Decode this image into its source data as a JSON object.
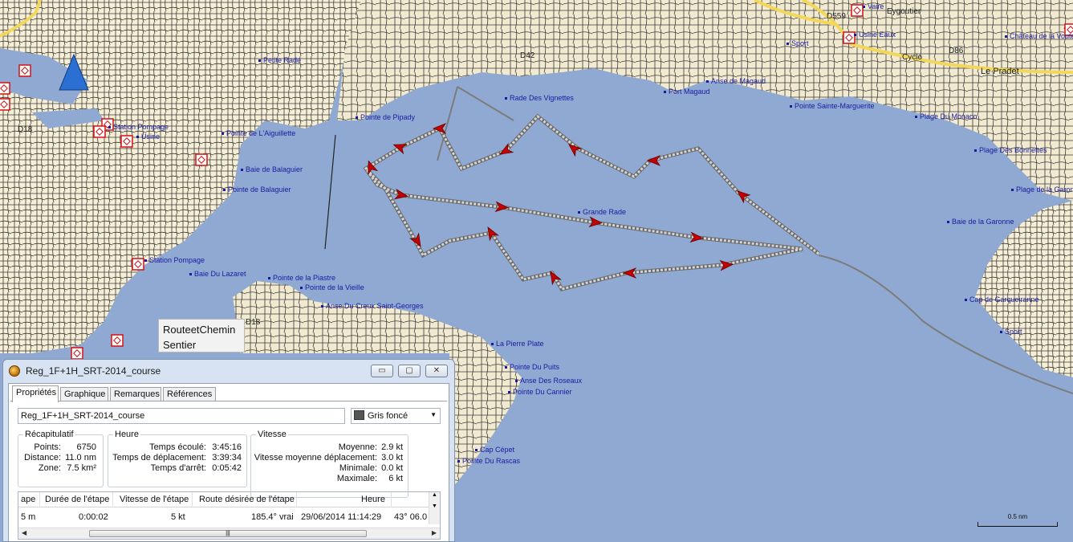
{
  "map": {
    "labels": [
      {
        "text": "Petite Rade"
      },
      {
        "text": "Rade Des Vignettes"
      },
      {
        "text": "Pointe de Pipady"
      },
      {
        "text": "Pointe de L'Aiguillette"
      },
      {
        "text": "Baie de Balaguier"
      },
      {
        "text": "Pointe de Balaguier"
      },
      {
        "text": "Station Pompage"
      },
      {
        "text": "Usine"
      },
      {
        "text": "Station Pompage"
      },
      {
        "text": "Baie Du Lazaret"
      },
      {
        "text": "Pointe de la Piastre"
      },
      {
        "text": "Pointe de la Vieille"
      },
      {
        "text": "Anse Du Creux Saint-Georges"
      },
      {
        "text": "Grande Rade"
      },
      {
        "text": "Port Magaud"
      },
      {
        "text": "Anse de Magaud"
      },
      {
        "text": "Pointe Sainte-Marguerite"
      },
      {
        "text": "Plage Du Monaco"
      },
      {
        "text": "Plage Des Bonnettes"
      },
      {
        "text": "Plage de la Garonne"
      },
      {
        "text": "Baie de la Garonne"
      },
      {
        "text": "Cap de Garqueiranne"
      },
      {
        "text": "Sport"
      },
      {
        "text": "La Pierre Plate"
      },
      {
        "text": "Pointe Du Puits"
      },
      {
        "text": "Anse Des Roseaux"
      },
      {
        "text": "Pointe Du Cannier"
      },
      {
        "text": "Cap Cépet"
      },
      {
        "text": "Pointe Du Rascas"
      },
      {
        "text": "Usine Eaux"
      },
      {
        "text": "Château de la Voute"
      },
      {
        "text": "Sport"
      },
      {
        "text": "Vaire"
      }
    ],
    "roads": [
      {
        "text": "D18"
      },
      {
        "text": "D18"
      },
      {
        "text": "D42"
      },
      {
        "text": "Le Pradet"
      },
      {
        "text": "Eygoutier"
      },
      {
        "text": "D86"
      },
      {
        "text": "Cyclo"
      },
      {
        "text": "D559"
      }
    ],
    "tooltip": {
      "line1": "RouteetChemin",
      "line2": "Sentier"
    },
    "scale_label": "0.5 nm",
    "colors": {
      "water": "#8fa9d2",
      "land": "#f4ecd2",
      "track": "#d4d4d4",
      "arrow": "#c40000"
    }
  },
  "window": {
    "title": "Reg_1F+1H_SRT-2014_course",
    "controls": [
      "▭",
      "▢",
      "✕"
    ],
    "tabs": [
      "Propriétés",
      "Graphique",
      "Remarques",
      "Références"
    ],
    "name_value": "Reg_1F+1H_SRT-2014_course",
    "color_value": "Gris foncé",
    "recap": {
      "title": "Récapitulatif",
      "rows": [
        {
          "label": "Points:",
          "value": "6750"
        },
        {
          "label": "Distance:",
          "value": "11.0 nm"
        },
        {
          "label": "Zone:",
          "value": "7.5 km²"
        }
      ]
    },
    "heure": {
      "title": "Heure",
      "rows": [
        {
          "label": "Temps écoulé:",
          "value": "3:45:16"
        },
        {
          "label": "Temps de déplacement:",
          "value": "3:39:34"
        },
        {
          "label": "Temps d'arrêt:",
          "value": "0:05:42"
        }
      ]
    },
    "vitesse": {
      "title": "Vitesse",
      "rows": [
        {
          "label": "Moyenne:",
          "value": "2.9 kt"
        },
        {
          "label": "Vitesse moyenne déplacement:",
          "value": "3.0 kt"
        },
        {
          "label": "Minimale:",
          "value": "0.0 kt"
        },
        {
          "label": "Maximale:",
          "value": "6 kt"
        }
      ]
    },
    "table": {
      "headers": [
        "ape",
        "Durée de l'étape",
        "Vitesse de l'étape",
        "Route désirée de l'étape",
        "Heure",
        ""
      ],
      "row": [
        "5 m",
        "0:00:02",
        "5 kt",
        "185.4° vrai",
        "29/06/2014 11:14:29",
        "43° 06.0"
      ]
    }
  }
}
